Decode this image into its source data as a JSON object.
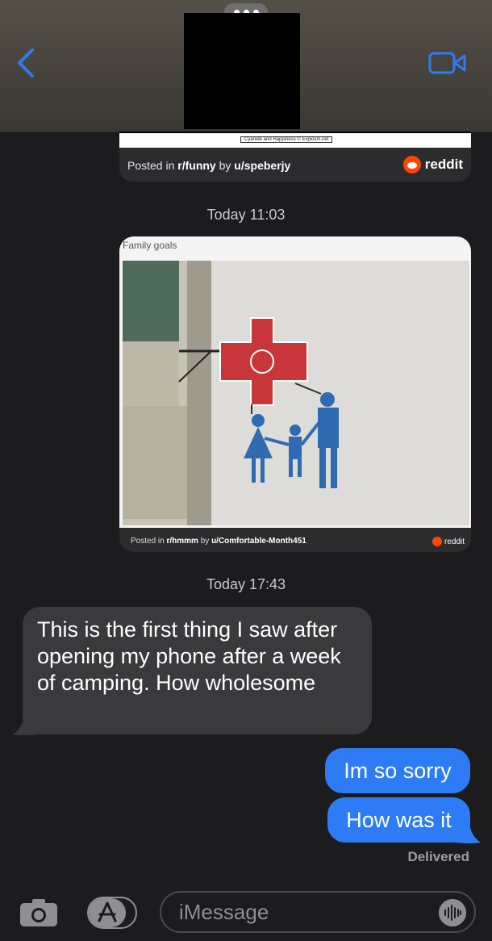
{
  "header": {
    "back_icon": "chevron-left-icon",
    "video_icon": "video-camera-icon",
    "accent_color": "#2d7cf6"
  },
  "messages": {
    "card1": {
      "credit": "Cyanide and Happiness © Explosm.net",
      "posted_prefix": "Posted in ",
      "subreddit": "r/funny",
      "by": " by ",
      "user": "u/speberjy",
      "source": "reddit"
    },
    "stamp1": "Today 11:03",
    "card2": {
      "title": "Family goals",
      "posted_prefix": "Posted in ",
      "subreddit": "r/hmmm",
      "by": " by ",
      "user": "u/Comfortable-Month451",
      "source": "reddit"
    },
    "stamp2": "Today 17:43",
    "incoming": "This is the first thing I saw after opening my phone after a week of camping. How wholesome",
    "outgoing": [
      "Im so sorry",
      "How was it"
    ],
    "status": "Delivered"
  },
  "composer": {
    "placeholder": "iMessage",
    "camera_icon": "camera-icon",
    "apps_icon": "app-store-icon",
    "audio_icon": "audio-waveform-icon"
  }
}
